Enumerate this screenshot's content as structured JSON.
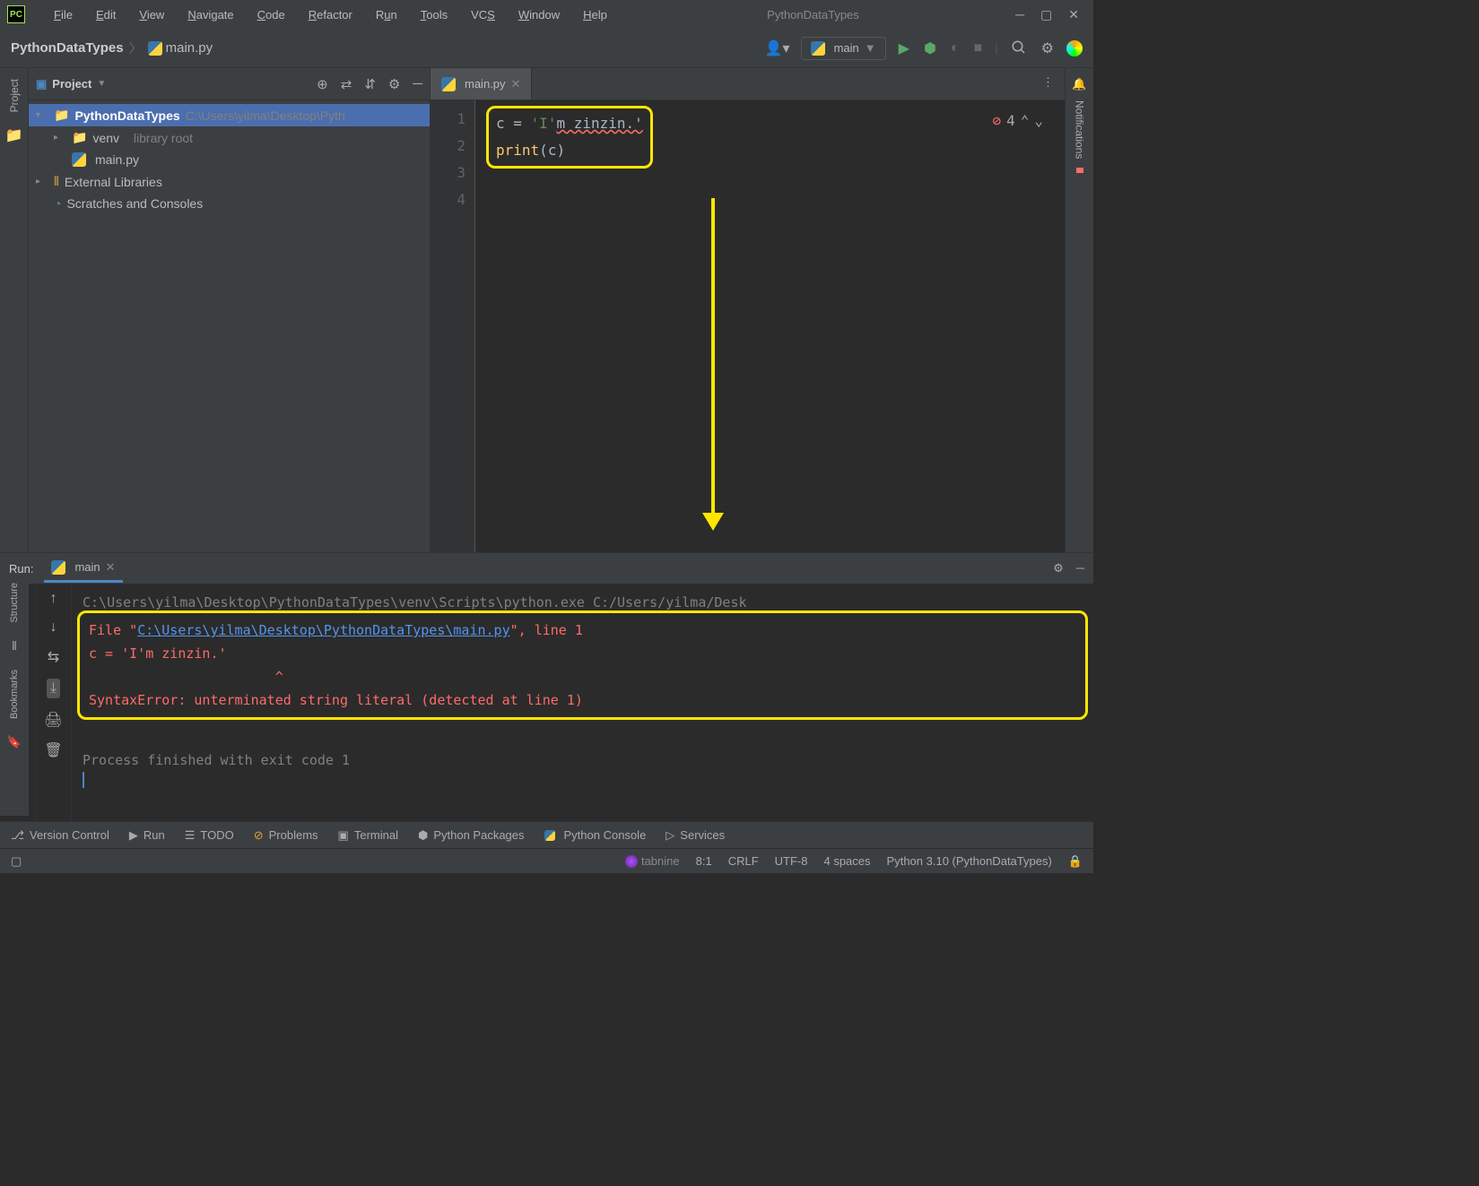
{
  "window": {
    "title": "PythonDataTypes"
  },
  "menu": {
    "file": "File",
    "edit": "Edit",
    "view": "View",
    "navigate": "Navigate",
    "code": "Code",
    "refactor": "Refactor",
    "run": "Run",
    "tools": "Tools",
    "vcs": "VCS",
    "window": "Window",
    "help": "Help"
  },
  "breadcrumb": {
    "project": "PythonDataTypes",
    "file": "main.py"
  },
  "toolbar": {
    "run_config": "main"
  },
  "project_panel": {
    "title": "Project",
    "root": "PythonDataTypes",
    "root_path": "C:\\Users\\yilma\\Desktop\\Pyth",
    "venv": "venv",
    "venv_hint": "library root",
    "mainfile": "main.py",
    "ext_libs": "External Libraries",
    "scratches": "Scratches and Consoles"
  },
  "editor": {
    "tab": "main.py",
    "line1_var": "c = ",
    "line1_str": "'I'",
    "line1_err": "m zinzin.'",
    "line2_fn": "print",
    "line2_open": "(",
    "line2_arg": "c",
    "line2_close": ")",
    "gutter": [
      "1",
      "2",
      "3",
      "4"
    ],
    "err_count": "4"
  },
  "right_panel": {
    "notifications": "Notifications"
  },
  "run_panel": {
    "title": "Run:",
    "tab": "main",
    "cmdline": "C:\\Users\\yilma\\Desktop\\PythonDataTypes\\venv\\Scripts\\python.exe C:/Users/yilma/Desk",
    "err_file": "  File \"",
    "err_link": "C:\\Users\\yilma\\Desktop\\PythonDataTypes\\main.py",
    "err_after": "\", line 1",
    "err_code": "    c = 'I'm zinzin.'",
    "err_caret": "                       ^",
    "err_msg": "SyntaxError: unterminated string literal (detected at line 1)",
    "exit": "Process finished with exit code 1"
  },
  "bottom": {
    "vcs": "Version Control",
    "run": "Run",
    "todo": "TODO",
    "problems": "Problems",
    "terminal": "Terminal",
    "packages": "Python Packages",
    "console": "Python Console",
    "services": "Services"
  },
  "status": {
    "tabnine": "tabnine",
    "pos": "8:1",
    "crlf": "CRLF",
    "encoding": "UTF-8",
    "indent": "4 spaces",
    "interpreter": "Python 3.10 (PythonDataTypes)"
  },
  "left_vert": {
    "project": "Project",
    "structure": "Structure",
    "bookmarks": "Bookmarks"
  }
}
